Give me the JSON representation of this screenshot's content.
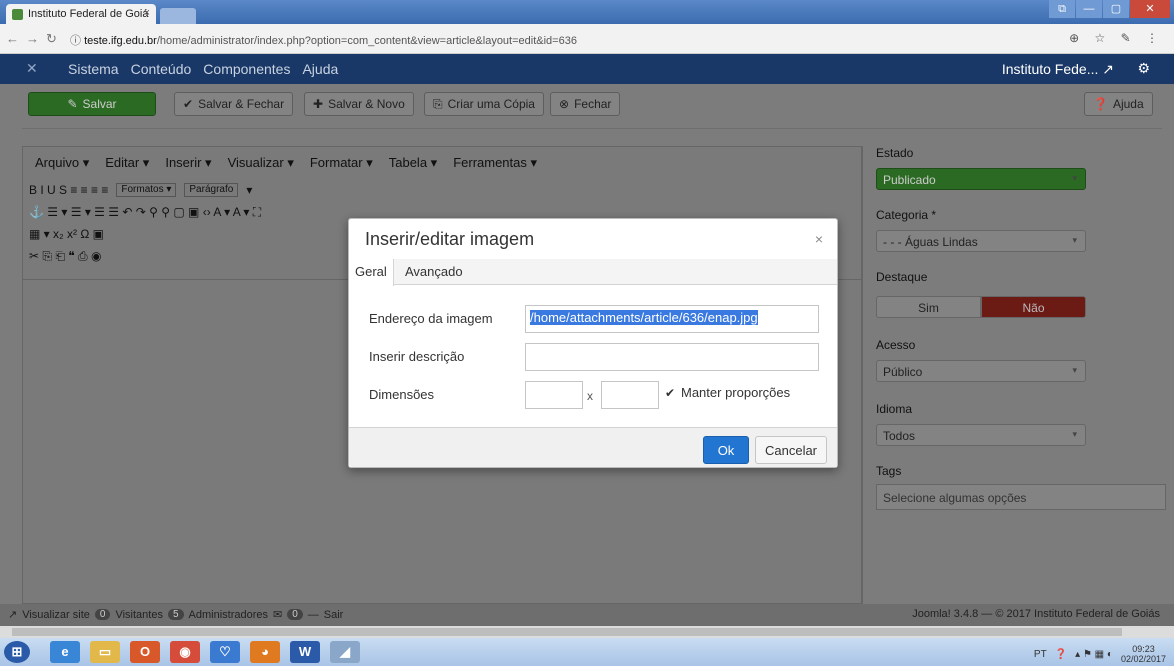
{
  "browser": {
    "tab_title": "Instituto Federal de Goiá",
    "tab_close": "×",
    "url_host": "teste.ifg.edu.br",
    "url_path": "/home/administrator/index.php?option=com_content&view=article&layout=edit&id=636",
    "addr_icons": "⊕ ☆ ✎ ⋮"
  },
  "joomla_menu": {
    "logo": "✕",
    "items": [
      "Sistema",
      "Conteúdo",
      "Componentes",
      "Ajuda"
    ],
    "site_name": "Instituto Fede... ↗",
    "gear": "⚙"
  },
  "toolbar": {
    "save": "Salvar",
    "save_close": "Salvar & Fechar",
    "save_new": "Salvar & Novo",
    "copy": "Criar uma Cópia",
    "close": "Fechar",
    "help": "Ajuda"
  },
  "editor": {
    "menus": [
      "Arquivo ▾",
      "Editar ▾",
      "Inserir ▾",
      "Visualizar ▾",
      "Formatar ▾",
      "Tabela ▾",
      "Ferramentas ▾"
    ],
    "row1": "B  I  U  S  ≡  ≡  ≡  ≡",
    "formats": "Formatos ▾",
    "paragraph": "Parágrafo",
    "row1_caret": "▾",
    "row2": "⚓  ☰ ▾  ☰ ▾  ☰  ☰  ↶  ↷  ⚲  ⚲  ▢  ▣  ‹›  A ▾  A ▾  ⛶",
    "row3": "▦ ▾  x₂  x²  Ω  ▣",
    "row4": "✂  ⎘  ⎗  ❝  ⎙  ◉"
  },
  "sidebar": {
    "estado_label": "Estado",
    "estado_value": "Publicado",
    "categoria_label": "Categoria *",
    "categoria_value": "- - - Águas Lindas",
    "destaque_label": "Destaque",
    "destaque_sim": "Sim",
    "destaque_nao": "Não",
    "acesso_label": "Acesso",
    "acesso_value": "Público",
    "idioma_label": "Idioma",
    "idioma_value": "Todos",
    "tags_label": "Tags",
    "tags_placeholder": "Selecione algumas opções",
    "caret": "▾"
  },
  "footer": {
    "view_site": "Visualizar site",
    "visitors_count": "0",
    "visitors": "Visitantes",
    "admins_count": "5",
    "admins": "Administradores",
    "messages_count": "0",
    "logout": "Sair",
    "version": "Joomla! 3.4.8 — © 2017 Instituto Federal de Goiás"
  },
  "taskbar": {
    "lang": "PT",
    "time": "09:23",
    "date": "02/02/2017"
  },
  "modal": {
    "title": "Inserir/editar imagem",
    "close": "×",
    "tab_general": "Geral",
    "tab_advanced": "Avançado",
    "src_label": "Endereço da imagem",
    "src_value": "/home/attachments/article/636/enap.jpg",
    "desc_label": "Inserir descrição",
    "desc_value": "",
    "dim_label": "Dimensões",
    "width_value": "",
    "x_sep": "x",
    "height_value": "",
    "constrain_label": "Manter proporções",
    "ok": "Ok",
    "cancel": "Cancelar"
  }
}
